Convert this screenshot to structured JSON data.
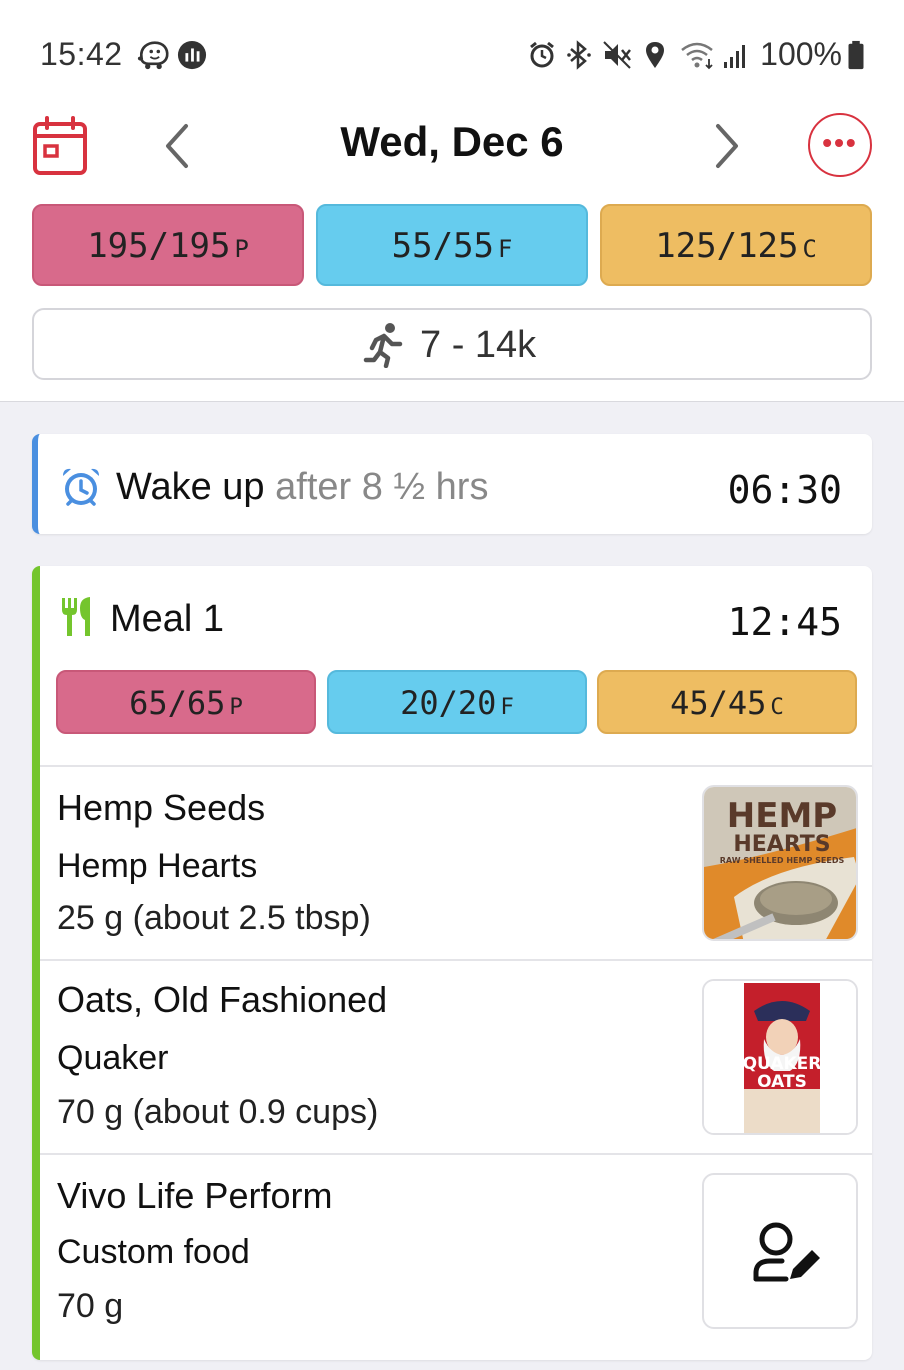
{
  "status_bar": {
    "time": "15:42",
    "left_icons": [
      "waze-icon",
      "activity-icon"
    ],
    "right_icons": [
      "alarm-icon",
      "bluetooth-icon",
      "mute-icon",
      "location-icon",
      "wifi-icon",
      "signal-icon"
    ],
    "battery": "100%"
  },
  "header": {
    "date": "Wed, Dec 6",
    "accent_color": "#d8323f"
  },
  "day_macros": {
    "protein": {
      "value": "195/195",
      "unit": "P"
    },
    "fat": {
      "value": "55/55",
      "unit": "F"
    },
    "carbs": {
      "value": "125/125",
      "unit": "C"
    }
  },
  "steps": {
    "label": "7 - 14k"
  },
  "wake": {
    "title": "Wake up",
    "subtitle": "after 8 ½ hrs",
    "time": "06:30"
  },
  "meal": {
    "title": "Meal 1",
    "time": "12:45",
    "macros": {
      "protein": {
        "value": "65/65",
        "unit": "P"
      },
      "fat": {
        "value": "20/20",
        "unit": "F"
      },
      "carbs": {
        "value": "45/45",
        "unit": "C"
      }
    },
    "foods": [
      {
        "name": "Hemp Seeds",
        "brand": "Hemp Hearts",
        "quantity": "25 g (about 2.5 tbsp)",
        "image_text": "HEMP",
        "image_text2": "HEARTS",
        "image_text3": "RAW SHELLED HEMP SEEDS"
      },
      {
        "name": "Oats, Old Fashioned",
        "brand": "Quaker",
        "quantity": "70 g (about 0.9 cups)",
        "image_text": "QUAKER",
        "image_text2": "OATS"
      },
      {
        "name": "Vivo Life Perform",
        "brand": "Custom food",
        "quantity": "70 g",
        "icon": "edit-user-icon"
      }
    ]
  },
  "colors": {
    "protein": "#d86a8b",
    "fat": "#66ccee",
    "carbs": "#eebd62",
    "wake_accent": "#4a8fe0",
    "meal_accent": "#74c52d"
  }
}
